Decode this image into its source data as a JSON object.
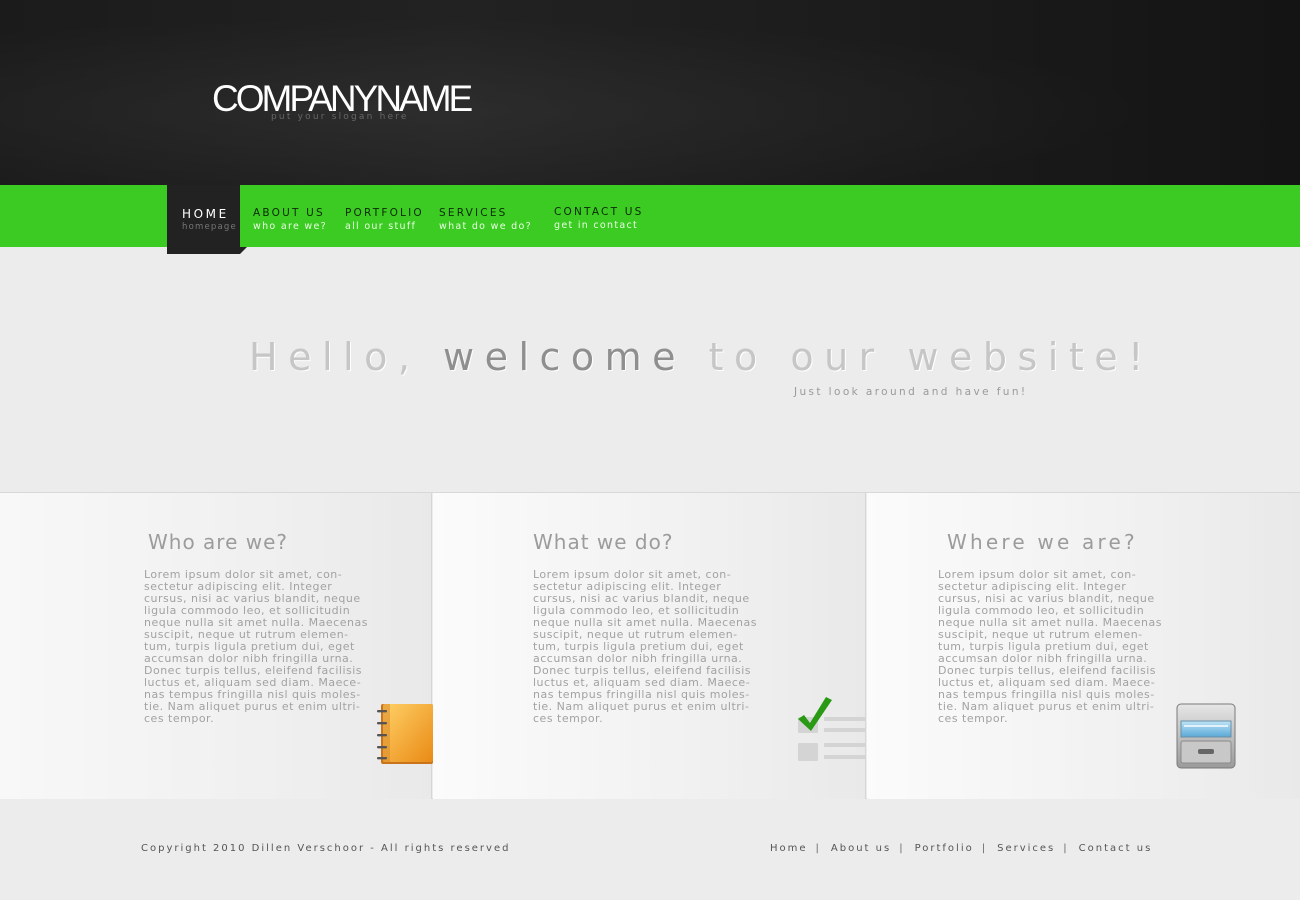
{
  "header": {
    "logo": "COMPANYNAME",
    "slogan": "put your slogan here"
  },
  "nav": {
    "items": [
      {
        "title": "HOME",
        "subtitle": "homepage",
        "active": true
      },
      {
        "title": "ABOUT US",
        "subtitle": "who are we?"
      },
      {
        "title": "PORTFOLIO",
        "subtitle": "all our stuff"
      },
      {
        "title": "SERVICES",
        "subtitle": "what do we do?"
      },
      {
        "title": "CONTACT US",
        "subtitle": "get in contact"
      }
    ]
  },
  "hero": {
    "title_part1": "Hello, ",
    "title_strong": "welcome",
    "title_part2": " to our website!",
    "subtitle": "Just look around and have fun!"
  },
  "boxes": [
    {
      "title": "Who are we?",
      "text": "Lorem ipsum dolor sit amet, con-sectetur adipiscing elit. Integer cursus, nisi ac varius blandit, neque ligula commodo leo, et sollicitudin neque nulla sit amet nulla. Maecenas suscipit, neque ut rutrum elemen-tum, turpis ligula pretium dui, eget accumsan dolor nibh fringilla urna. Donec turpis tellus, eleifend facilisis luctus et, aliquam sed diam. Maece-nas tempus fringilla nisl quis moles-tie. Nam aliquet purus et enim ultri-ces tempor.",
      "icon": "notebook-icon"
    },
    {
      "title": "What we do?",
      "text": "Lorem ipsum dolor sit amet, con-sectetur adipiscing elit. Integer cursus, nisi ac varius blandit, neque ligula commodo leo, et sollicitudin neque nulla sit amet nulla. Maecenas suscipit, neque ut rutrum elemen-tum, turpis ligula pretium dui, eget accumsan dolor nibh fringilla urna. Donec turpis tellus, eleifend facilisis luctus et, aliquam sed diam. Maece-nas tempus fringilla nisl quis moles-tie. Nam aliquet purus et enim ultri-ces tempor.",
      "icon": "checklist-icon"
    },
    {
      "title": "Where we are?",
      "text": "Lorem ipsum dolor sit amet, con-sectetur adipiscing elit. Integer cursus, nisi ac varius blandit, neque ligula commodo leo, et sollicitudin neque nulla sit amet nulla. Maecenas suscipit, neque ut rutrum elemen-tum, turpis ligula pretium dui, eget accumsan dolor nibh fringilla urna. Donec turpis tellus, eleifend facilisis luctus et, aliquam sed diam. Maece-nas tempus fringilla nisl quis moles-tie. Nam aliquet purus et enim ultri-ces tempor.",
      "icon": "file-cabinet-icon"
    }
  ],
  "footer": {
    "copyright": "Copyright 2010 Dillen Verschoor - All rights reserved",
    "links": [
      "Home",
      "About us",
      "Portfolio",
      "Services",
      "Contact us"
    ],
    "separator": "|"
  },
  "colors": {
    "accent_green": "#3ccb23",
    "header_dark": "#1d1d1d",
    "active_tab": "#222222",
    "background": "#ececec"
  }
}
